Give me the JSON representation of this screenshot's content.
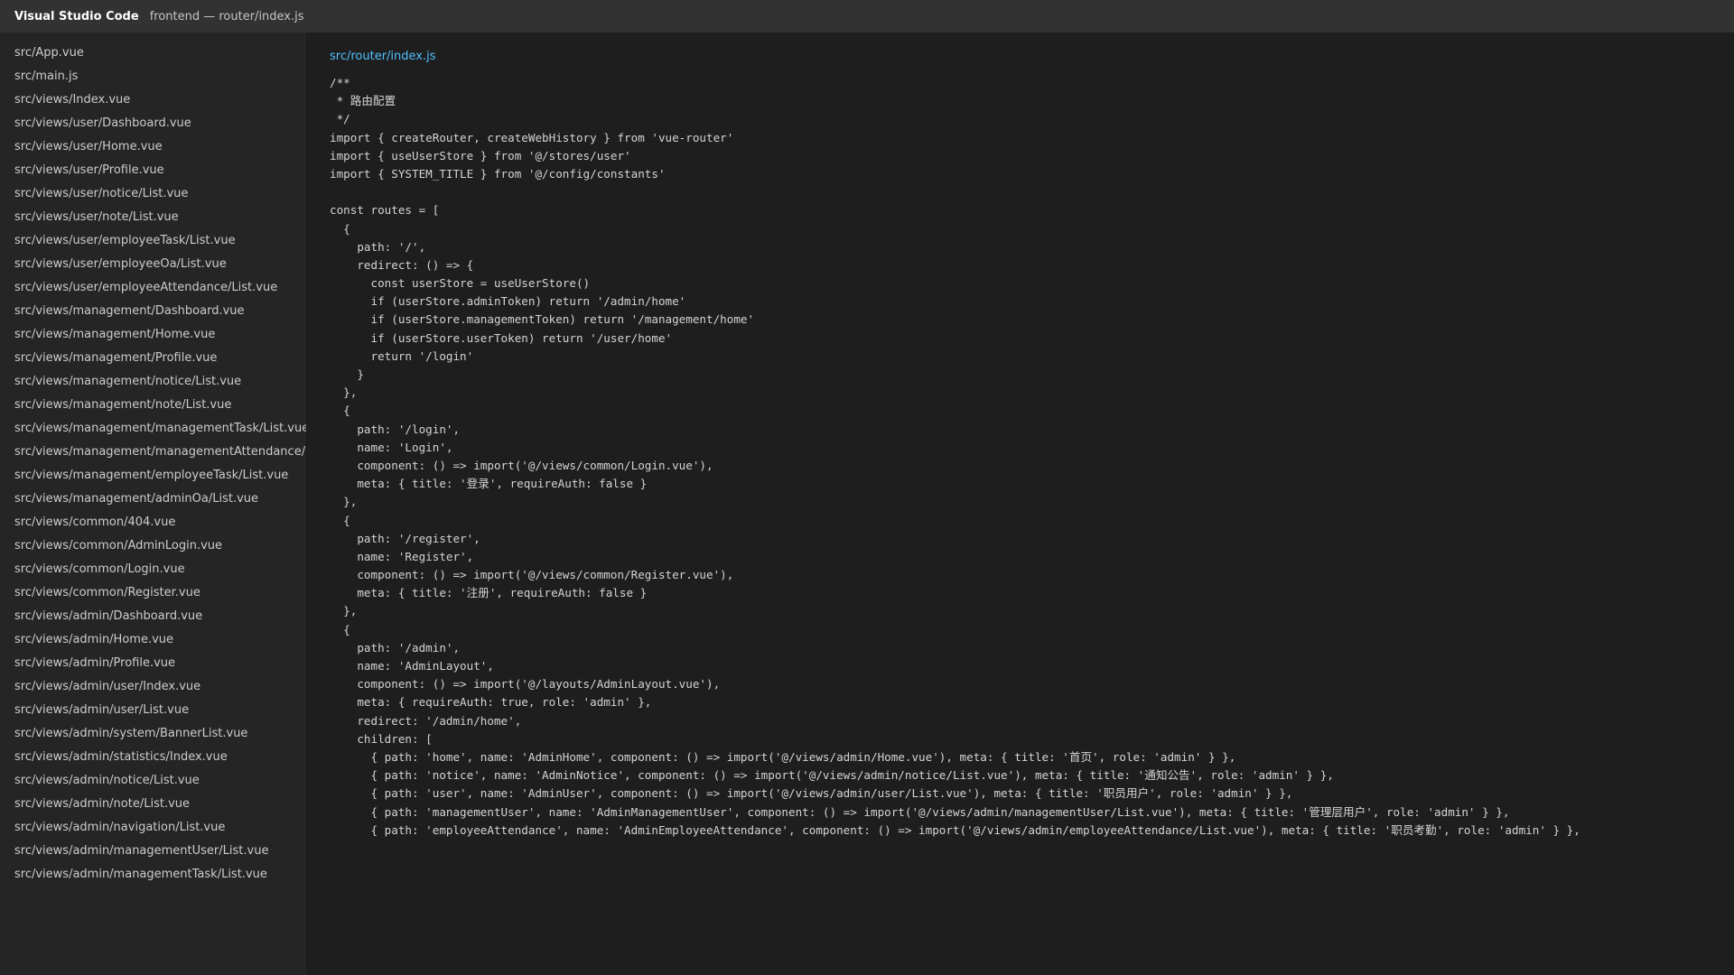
{
  "titlebar": {
    "app_name": "Visual Studio Code",
    "window_title": "frontend — router/index.js"
  },
  "explorer": {
    "files": [
      "src/App.vue",
      "src/main.js",
      "src/views/Index.vue",
      "src/views/user/Dashboard.vue",
      "src/views/user/Home.vue",
      "src/views/user/Profile.vue",
      "src/views/user/notice/List.vue",
      "src/views/user/note/List.vue",
      "src/views/user/employeeTask/List.vue",
      "src/views/user/employeeOa/List.vue",
      "src/views/user/employeeAttendance/List.vue",
      "src/views/management/Dashboard.vue",
      "src/views/management/Home.vue",
      "src/views/management/Profile.vue",
      "src/views/management/notice/List.vue",
      "src/views/management/note/List.vue",
      "src/views/management/managementTask/List.vue",
      "src/views/management/managementAttendance/List.vue",
      "src/views/management/employeeTask/List.vue",
      "src/views/management/adminOa/List.vue",
      "src/views/common/404.vue",
      "src/views/common/AdminLogin.vue",
      "src/views/common/Login.vue",
      "src/views/common/Register.vue",
      "src/views/admin/Dashboard.vue",
      "src/views/admin/Home.vue",
      "src/views/admin/Profile.vue",
      "src/views/admin/user/Index.vue",
      "src/views/admin/user/List.vue",
      "src/views/admin/system/BannerList.vue",
      "src/views/admin/statistics/Index.vue",
      "src/views/admin/notice/List.vue",
      "src/views/admin/note/List.vue",
      "src/views/admin/navigation/List.vue",
      "src/views/admin/managementUser/List.vue",
      "src/views/admin/managementTask/List.vue"
    ]
  },
  "editor": {
    "file_path": "src/router/index.js",
    "lines": [
      "/**",
      " * 路由配置",
      " */",
      "import { createRouter, createWebHistory } from 'vue-router'",
      "import { useUserStore } from '@/stores/user'",
      "import { SYSTEM_TITLE } from '@/config/constants'",
      "",
      "const routes = [",
      "  {",
      "    path: '/',",
      "    redirect: () => {",
      "      const userStore = useUserStore()",
      "      if (userStore.adminToken) return '/admin/home'",
      "      if (userStore.managementToken) return '/management/home'",
      "      if (userStore.userToken) return '/user/home'",
      "      return '/login'",
      "    }",
      "  },",
      "  {",
      "    path: '/login',",
      "    name: 'Login',",
      "    component: () => import('@/views/common/Login.vue'),",
      "    meta: { title: '登录', requireAuth: false }",
      "  },",
      "  {",
      "    path: '/register',",
      "    name: 'Register',",
      "    component: () => import('@/views/common/Register.vue'),",
      "    meta: { title: '注册', requireAuth: false }",
      "  },",
      "  {",
      "    path: '/admin',",
      "    name: 'AdminLayout',",
      "    component: () => import('@/layouts/AdminLayout.vue'),",
      "    meta: { requireAuth: true, role: 'admin' },",
      "    redirect: '/admin/home',",
      "    children: [",
      "      { path: 'home', name: 'AdminHome', component: () => import('@/views/admin/Home.vue'), meta: { title: '首页', role: 'admin' } },",
      "      { path: 'notice', name: 'AdminNotice', component: () => import('@/views/admin/notice/List.vue'), meta: { title: '通知公告', role: 'admin' } },",
      "      { path: 'user', name: 'AdminUser', component: () => import('@/views/admin/user/List.vue'), meta: { title: '职员用户', role: 'admin' } },",
      "      { path: 'managementUser', name: 'AdminManagementUser', component: () => import('@/views/admin/managementUser/List.vue'), meta: { title: '管理层用户', role: 'admin' } },",
      "      { path: 'employeeAttendance', name: 'AdminEmployeeAttendance', component: () => import('@/views/admin/employeeAttendance/List.vue'), meta: { title: '职员考勤', role: 'admin' } },"
    ]
  }
}
